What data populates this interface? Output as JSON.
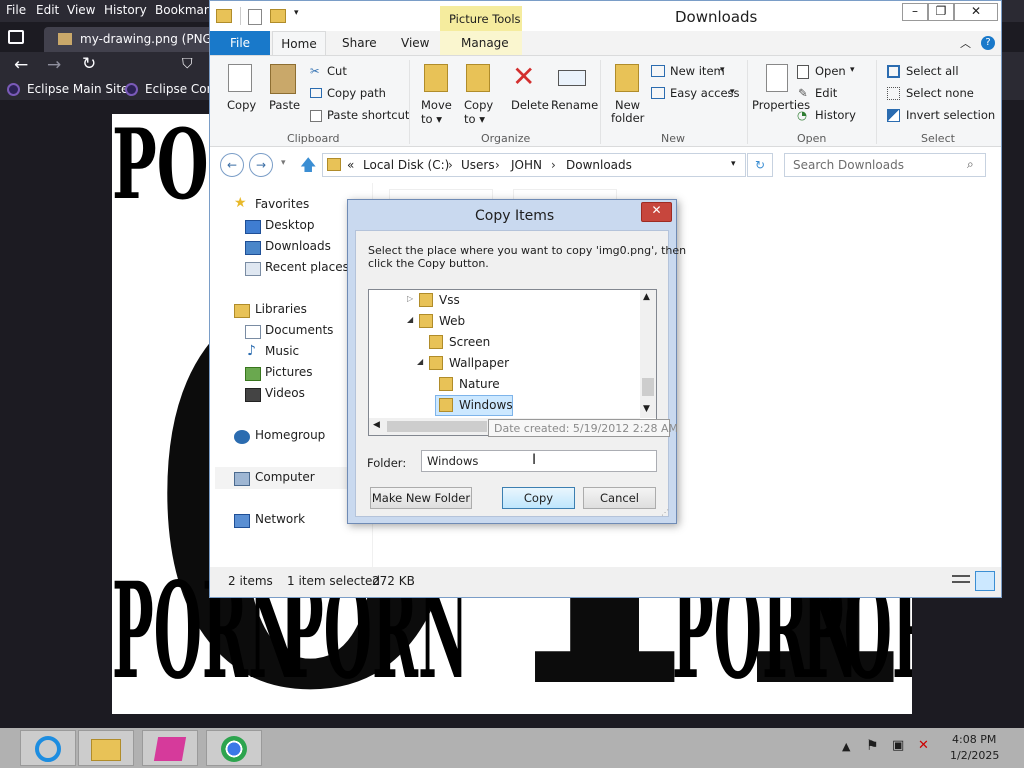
{
  "firefox": {
    "menu": [
      "File",
      "Edit",
      "View",
      "History",
      "Bookmarks"
    ],
    "tab_title": "my-drawing.png (PNG Im",
    "bookmarks": [
      "Eclipse Main Site",
      "Eclipse Comm"
    ]
  },
  "image": {
    "repeated_word": "PORN",
    "big_letters": "OTR"
  },
  "explorer": {
    "title": "Downloads",
    "contextual_tab_group": "Picture Tools",
    "tabs": [
      "File",
      "Home",
      "Share",
      "View",
      "Manage"
    ],
    "ribbon": {
      "clipboard": {
        "label": "Clipboard",
        "copy": "Copy",
        "paste": "Paste",
        "cut": "Cut",
        "copy_path": "Copy path",
        "paste_shortcut": "Paste shortcut"
      },
      "organize": {
        "label": "Organize",
        "move_to": "Move\nto",
        "copy_to": "Copy\nto",
        "delete": "Delete",
        "rename": "Rename"
      },
      "new": {
        "label": "New",
        "new_folder_1": "New",
        "new_folder_2": "folder",
        "new_item": "New item",
        "easy_access": "Easy access"
      },
      "open": {
        "label": "Open",
        "properties": "Properties",
        "open": "Open",
        "edit": "Edit",
        "history": "History"
      },
      "select": {
        "label": "Select",
        "select_all": "Select all",
        "select_none": "Select none",
        "invert": "Invert selection"
      }
    },
    "address": {
      "prefix": "«",
      "crumbs": [
        "Local Disk (C:)",
        "JOHN",
        "Downloads"
      ],
      "users": "Users"
    },
    "search_placeholder": "Search Downloads",
    "nav": {
      "favorites": "Favorites",
      "desktop": "Desktop",
      "downloads": "Downloads",
      "recent": "Recent places",
      "libraries": "Libraries",
      "documents": "Documents",
      "music": "Music",
      "pictures": "Pictures",
      "videos": "Videos",
      "homegroup": "Homegroup",
      "computer": "Computer",
      "network": "Network"
    },
    "status": {
      "items": "2 items",
      "selected": "1 item selected",
      "size": "272 KB"
    }
  },
  "dialog": {
    "title": "Copy Items",
    "instruction_1": "Select the place where you want to copy 'img0.png', then",
    "instruction_2": "click the Copy button.",
    "tree": [
      {
        "label": "Vss",
        "level": 0,
        "expander": "collapsed"
      },
      {
        "label": "Web",
        "level": 0,
        "expander": "expanded"
      },
      {
        "label": "Screen",
        "level": 1,
        "expander": "none"
      },
      {
        "label": "Wallpaper",
        "level": 1,
        "expander": "expanded"
      },
      {
        "label": "Nature",
        "level": 2,
        "expander": "none"
      },
      {
        "label": "Windows",
        "level": 2,
        "expander": "none",
        "selected": true
      }
    ],
    "tooltip": "Date created: 5/19/2012 2:28 AM",
    "folder_label": "Folder:",
    "folder_value": "Windows",
    "make_new_folder": "Make New Folder",
    "copy": "Copy",
    "cancel": "Cancel"
  },
  "taskbar": {
    "time": "4:08 PM",
    "date": "1/2/2025"
  },
  "colors": {
    "ribbon_file_tab": "#1979ca",
    "picture_tools": "#f5ec9e",
    "dialog_close": "#c7463d",
    "selection": "#cce8ff"
  }
}
